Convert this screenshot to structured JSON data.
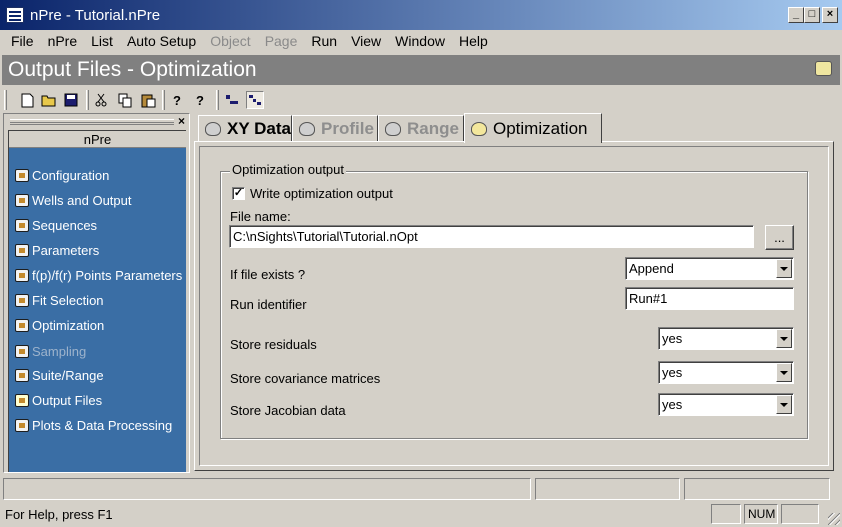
{
  "window": {
    "title": "nPre - Tutorial.nPre",
    "minimize": "_",
    "maximize": "□",
    "close": "×"
  },
  "menu": {
    "items": [
      {
        "label": "File",
        "enabled": true
      },
      {
        "label": "nPre",
        "enabled": true
      },
      {
        "label": "List",
        "enabled": true
      },
      {
        "label": "Auto Setup",
        "enabled": true
      },
      {
        "label": "Object",
        "enabled": false
      },
      {
        "label": "Page",
        "enabled": false
      },
      {
        "label": "Run",
        "enabled": true
      },
      {
        "label": "View",
        "enabled": true
      },
      {
        "label": "Window",
        "enabled": true
      },
      {
        "label": "Help",
        "enabled": true
      }
    ]
  },
  "header": {
    "title": "Output Files - Optimization"
  },
  "toolbar": {
    "buttons": [
      "new-file-icon",
      "open-folder-icon",
      "save-icon",
      "cut-icon",
      "copy-icon",
      "paste-icon",
      "help-icon",
      "context-help-icon",
      "view-a-icon",
      "view-b-icon"
    ]
  },
  "sidebar": {
    "close": "×",
    "title": "nPre",
    "items": [
      {
        "label": "Configuration",
        "enabled": true
      },
      {
        "label": "Wells and Output",
        "enabled": true
      },
      {
        "label": "Sequences",
        "enabled": true
      },
      {
        "label": "Parameters",
        "enabled": true
      },
      {
        "label": "f(p)/f(r) Points Parameters",
        "enabled": true
      },
      {
        "label": "Fit Selection",
        "enabled": true
      },
      {
        "label": "Optimization",
        "enabled": true
      },
      {
        "label": "Sampling",
        "enabled": false
      },
      {
        "label": "Suite/Range",
        "enabled": true
      },
      {
        "label": "Output Files",
        "enabled": true,
        "selected": true
      },
      {
        "label": "Plots & Data Processing",
        "enabled": true
      }
    ]
  },
  "tabs": [
    {
      "label": "XY Data",
      "enabled": true
    },
    {
      "label": "Profile",
      "enabled": false
    },
    {
      "label": "Range",
      "enabled": false
    },
    {
      "label": "Optimization",
      "enabled": true,
      "active": true
    }
  ],
  "form": {
    "group_title": "Optimization output",
    "write_output_label": "Write optimization output",
    "write_output_checked": true,
    "check_mark": "✓",
    "file_name_label": "File name:",
    "file_name_value": "C:\\nSights\\Tutorial\\Tutorial.nOpt",
    "browse_label": "...",
    "if_exists_label": "If file exists ?",
    "if_exists_value": "Append",
    "run_id_label": "Run identifier",
    "run_id_value": "Run#1",
    "store_residuals_label": "Store residuals",
    "store_residuals_value": "yes",
    "store_covariance_label": "Store covariance matrices",
    "store_covariance_value": "yes",
    "store_jacobian_label": "Store Jacobian data",
    "store_jacobian_value": "yes"
  },
  "status": {
    "help_text": "For Help, press F1",
    "num": "NUM"
  }
}
